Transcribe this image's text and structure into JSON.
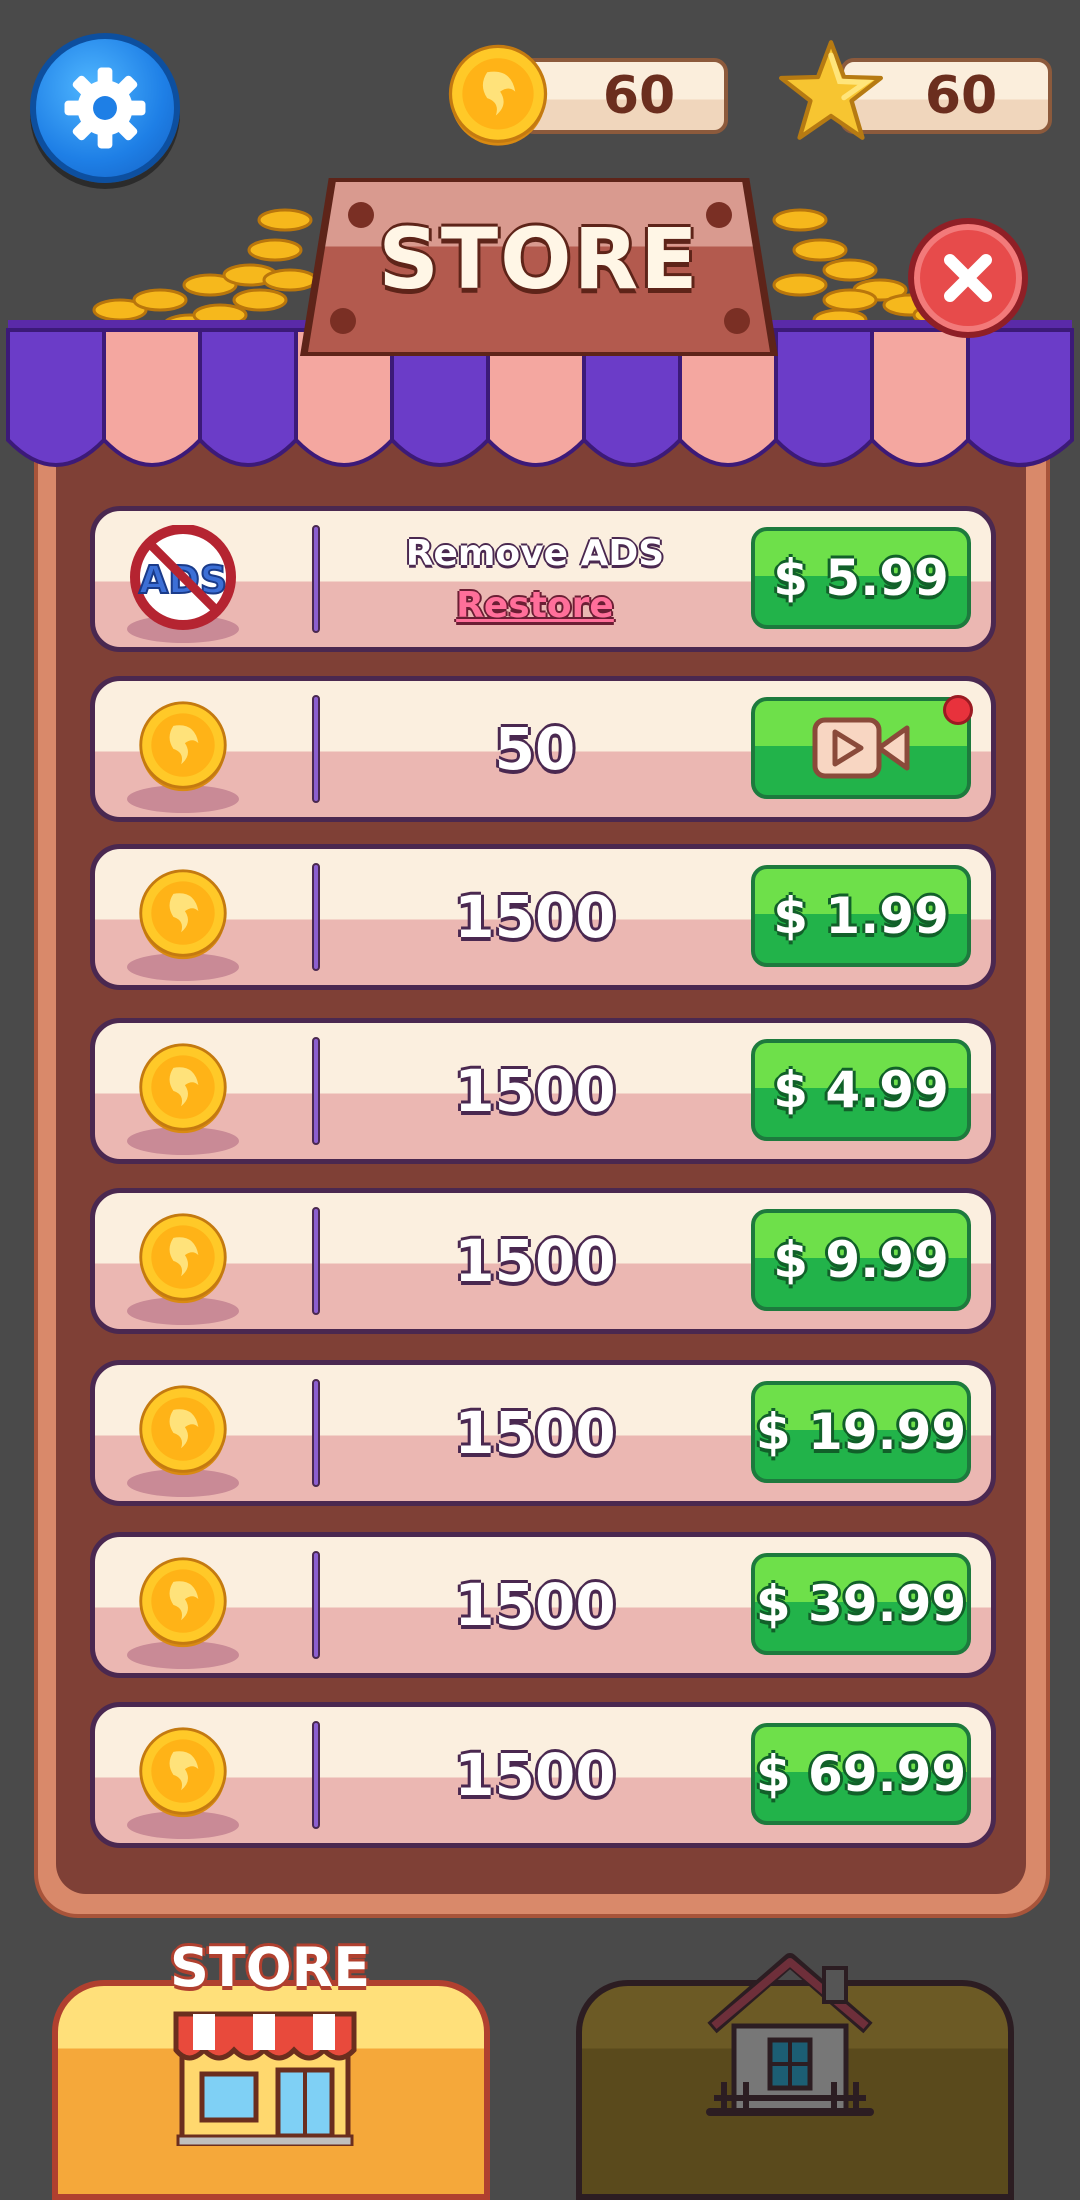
{
  "hud": {
    "coins": "60",
    "stars": "60"
  },
  "title": "STORE",
  "rows": [
    {
      "icon": "no-ads-icon",
      "label": "Remove ADS",
      "restore": "Restore",
      "price": "$ 5.99"
    },
    {
      "icon": "coin-icon",
      "amount": "50",
      "action": "video-ad-icon",
      "has_notification": true
    },
    {
      "icon": "coin-icon",
      "amount": "1500",
      "price": "$ 1.99"
    },
    {
      "icon": "coin-icon",
      "amount": "1500",
      "price": "$ 4.99"
    },
    {
      "icon": "coin-icon",
      "amount": "1500",
      "price": "$ 9.99"
    },
    {
      "icon": "coin-icon",
      "amount": "1500",
      "price": "$ 19.99"
    },
    {
      "icon": "coin-icon",
      "amount": "1500",
      "price": "$ 39.99"
    },
    {
      "icon": "coin-icon",
      "amount": "1500",
      "price": "$ 69.99"
    }
  ],
  "no_ads_badge": "ADS",
  "bottom_nav": {
    "store_label": "STORE",
    "tabs": [
      {
        "name": "store",
        "icon": "store-icon",
        "active": true
      },
      {
        "name": "home",
        "icon": "house-icon",
        "active": false
      }
    ]
  },
  "colors": {
    "background": "#4a4a4a",
    "panel": "#7f4036",
    "buy_button": "#22b34a",
    "awning_purple": "#6b3cc8",
    "awning_pink": "#f4a7a0",
    "close_button": "#e74b4b",
    "settings_button": "#1e7fe6"
  }
}
